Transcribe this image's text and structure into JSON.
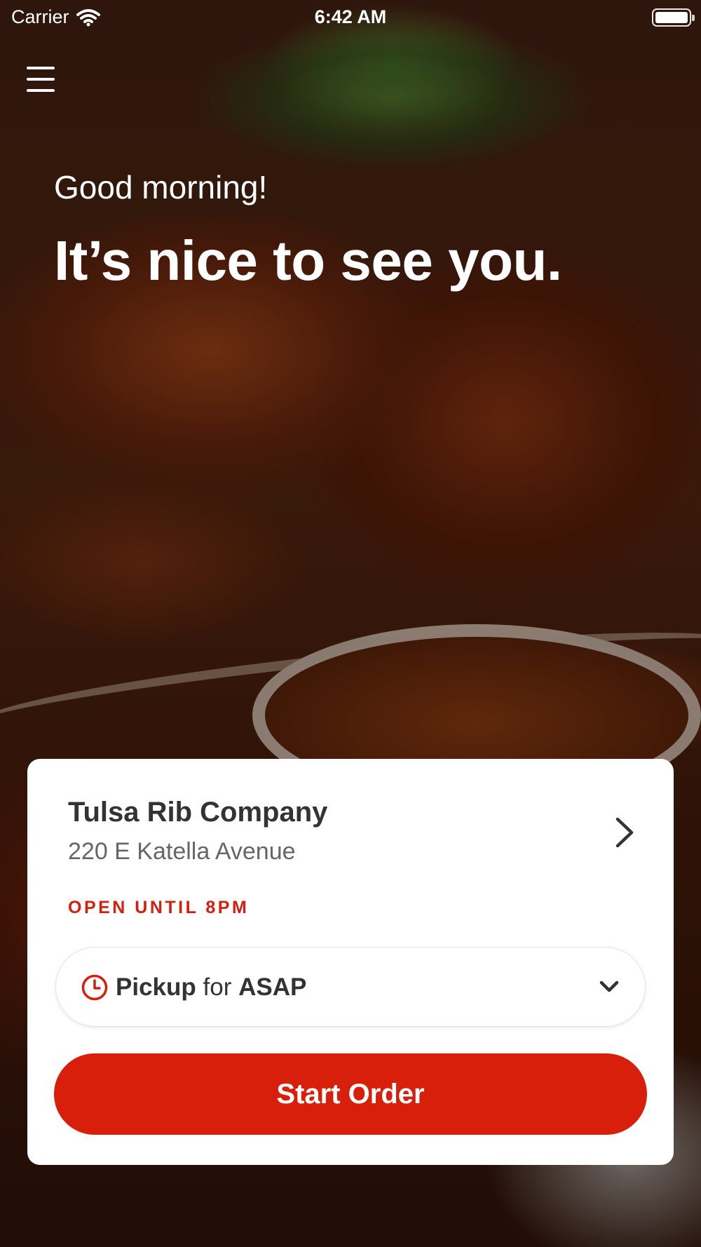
{
  "status_bar": {
    "carrier": "Carrier",
    "time": "6:42 AM"
  },
  "icons": {
    "menu": "hamburger-menu-icon",
    "wifi": "wifi-icon",
    "battery": "battery-icon",
    "chevron_right": "chevron-right-icon",
    "clock": "clock-icon",
    "chevron_down": "chevron-down-icon"
  },
  "hero": {
    "greeting": "Good morning!",
    "headline": "It’s nice to see you."
  },
  "store_card": {
    "name": "Tulsa Rib Company",
    "address": "220 E Katella Avenue",
    "open_status": "OPEN UNTIL 8PM",
    "order_mode": {
      "mode": "Pickup",
      "connector": "for",
      "time": "ASAP"
    },
    "start_order_label": "Start Order"
  },
  "colors": {
    "accent": "#d81f0b",
    "open_status": "#d31f0d"
  }
}
